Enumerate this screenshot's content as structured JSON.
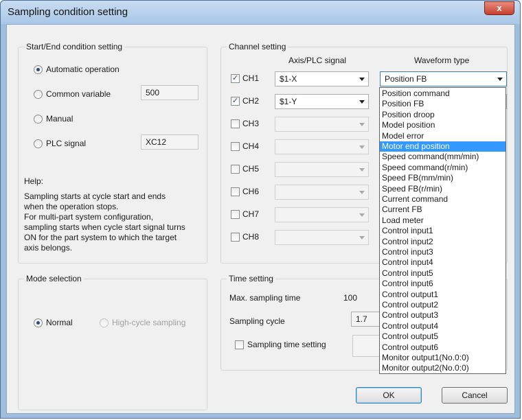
{
  "window": {
    "title": "Sampling condition setting",
    "close_symbol": "x"
  },
  "start_end": {
    "legend": "Start/End condition setting",
    "automatic": "Automatic operation",
    "common_variable": "Common variable",
    "common_variable_value": "500",
    "manual": "Manual",
    "plc_signal": "PLC signal",
    "plc_signal_value": "XC12",
    "help_title": "Help:",
    "help_lines": [
      "Sampling starts at cycle start and ends",
      "when the operation stops.",
      "For multi-part system configuration,",
      "sampling starts when cycle start signal turns",
      "ON for the part system to which the target",
      "axis belongs."
    ]
  },
  "channel": {
    "legend": "Channel setting",
    "col_axis": "Axis/PLC signal",
    "col_waveform": "Waveform type",
    "rows": [
      {
        "label": "CH1",
        "checked": true,
        "axis": "$1-X",
        "waveform": "Position FB"
      },
      {
        "label": "CH2",
        "checked": true,
        "axis": "$1-Y",
        "waveform": ""
      },
      {
        "label": "CH3",
        "checked": false,
        "axis": "",
        "waveform": ""
      },
      {
        "label": "CH4",
        "checked": false,
        "axis": "",
        "waveform": ""
      },
      {
        "label": "CH5",
        "checked": false,
        "axis": "",
        "waveform": ""
      },
      {
        "label": "CH6",
        "checked": false,
        "axis": "",
        "waveform": ""
      },
      {
        "label": "CH7",
        "checked": false,
        "axis": "",
        "waveform": ""
      },
      {
        "label": "CH8",
        "checked": false,
        "axis": "",
        "waveform": ""
      }
    ],
    "check_mark": "✓"
  },
  "waveform_options": [
    "Position command",
    "Position FB",
    "Position droop",
    "Model position",
    "Model error",
    "Motor end position",
    "Speed command(mm/min)",
    "Speed command(r/min)",
    "Speed FB(mm/min)",
    "Speed FB(r/min)",
    "Current command",
    "Current FB",
    "Load meter",
    "Control input1",
    "Control input2",
    "Control input3",
    "Control input4",
    "Control input5",
    "Control input6",
    "Control output1",
    "Control output2",
    "Control output3",
    "Control output4",
    "Control output5",
    "Control output6",
    "Monitor output1(No.0:0)",
    "Monitor output2(No.0:0)"
  ],
  "waveform_highlighted": "Motor end position",
  "mode": {
    "legend": "Mode selection",
    "normal": "Normal",
    "high_cycle": "High-cycle sampling"
  },
  "time": {
    "legend": "Time setting",
    "max_label": "Max. sampling time",
    "max_value": "100",
    "cycle_label": "Sampling cycle",
    "cycle_value": "1.7",
    "time_setting_label": "Sampling time setting"
  },
  "buttons": {
    "ok": "OK",
    "cancel": "Cancel"
  }
}
